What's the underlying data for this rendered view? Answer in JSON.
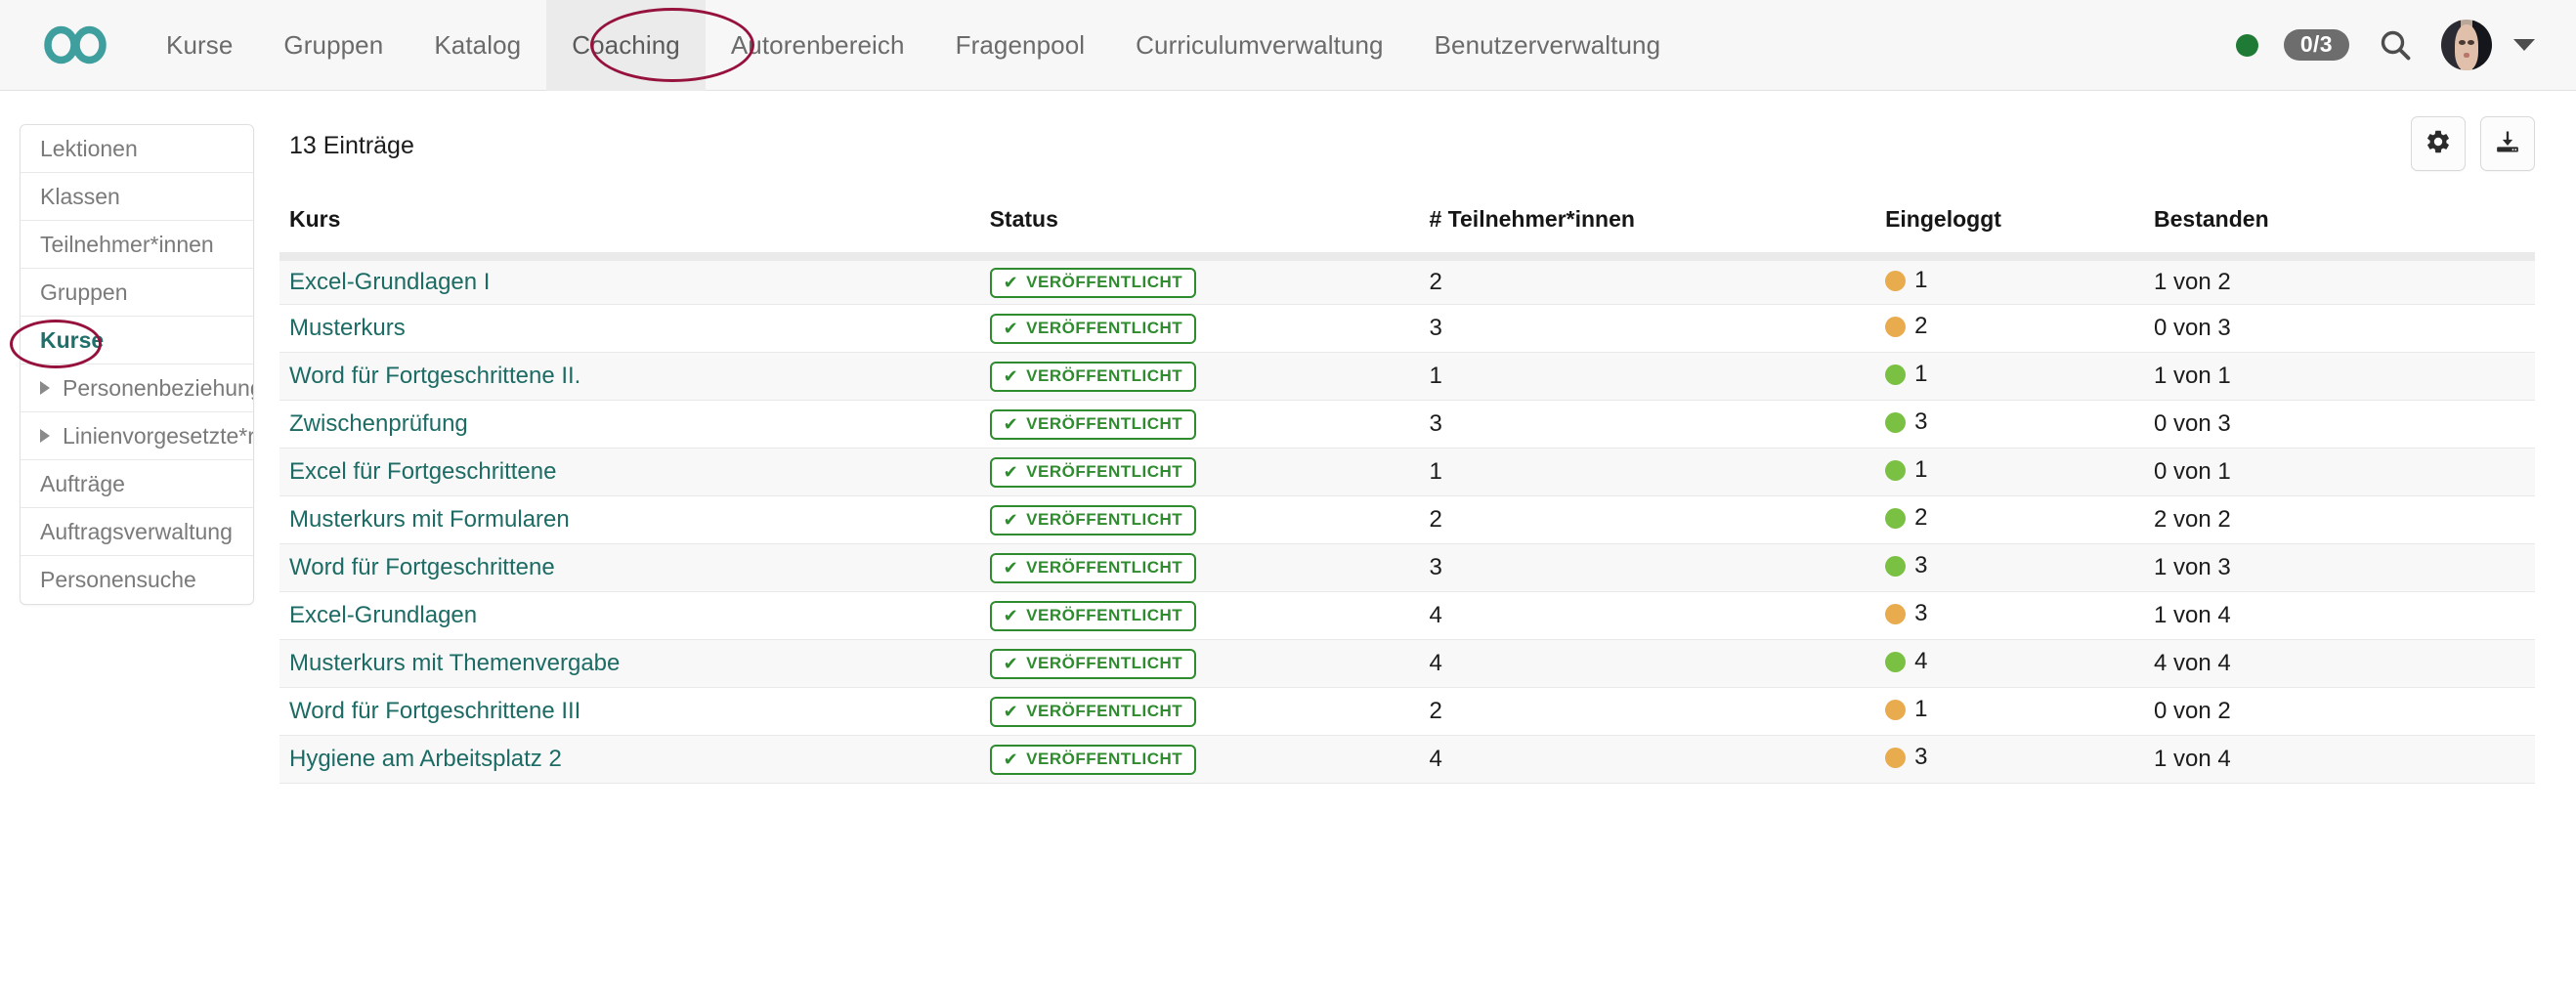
{
  "header": {
    "logo_icon": "infinity-logo",
    "nav_items": [
      {
        "label": "Kurse",
        "active": false
      },
      {
        "label": "Gruppen",
        "active": false
      },
      {
        "label": "Katalog",
        "active": false
      },
      {
        "label": "Coaching",
        "active": true
      },
      {
        "label": "Autorenbereich",
        "active": false
      },
      {
        "label": "Fragenpool",
        "active": false
      },
      {
        "label": "Curriculumverwaltung",
        "active": false
      },
      {
        "label": "Benutzerverwaltung",
        "active": false
      }
    ],
    "status_dot_color": "#1f7a35",
    "task_badge": "0/3",
    "search_icon": "search-icon",
    "avatar_icon": "user-avatar",
    "account_caret_icon": "chevron-down-icon"
  },
  "annotations": [
    {
      "name": "coaching-nav-highlight",
      "color": "#96123c"
    },
    {
      "name": "kurse-sidebar-highlight",
      "color": "#96123c"
    }
  ],
  "sidebar": {
    "items": [
      {
        "label": "Lektionen",
        "expandable": false,
        "current": false
      },
      {
        "label": "Klassen",
        "expandable": false,
        "current": false
      },
      {
        "label": "Teilnehmer*innen",
        "expandable": false,
        "current": false
      },
      {
        "label": "Gruppen",
        "expandable": false,
        "current": false
      },
      {
        "label": "Kurse",
        "expandable": false,
        "current": true
      },
      {
        "label": "Personenbeziehungen",
        "expandable": true,
        "current": false
      },
      {
        "label": "Linienvorgesetzte*r",
        "expandable": true,
        "current": false
      },
      {
        "label": "Aufträge",
        "expandable": false,
        "current": false
      },
      {
        "label": "Auftragsverwaltung",
        "expandable": false,
        "current": false
      },
      {
        "label": "Personensuche",
        "expandable": false,
        "current": false
      }
    ]
  },
  "main": {
    "entry_count_label": "13 Einträge",
    "actions": [
      {
        "name": "settings-button",
        "icon": "gear-icon"
      },
      {
        "name": "download-button",
        "icon": "download-icon"
      }
    ],
    "table": {
      "columns": [
        "Kurs",
        "Status",
        "# Teilnehmer*innen",
        "Eingeloggt",
        "Bestanden"
      ],
      "status_badge_label": "VERÖFFENTLICHT",
      "status_badge_icon": "check-icon",
      "rows": [
        {
          "kurs": "Excel-Grundlagen I",
          "status": "VERÖFFENTLICHT",
          "teilnehmer": "2",
          "eingeloggt": "1",
          "eingeloggt_dot": "orange",
          "bestanden": "1 von 2"
        },
        {
          "kurs": "Musterkurs",
          "status": "VERÖFFENTLICHT",
          "teilnehmer": "3",
          "eingeloggt": "2",
          "eingeloggt_dot": "orange",
          "bestanden": "0 von 3"
        },
        {
          "kurs": "Word für Fortgeschrittene II.",
          "status": "VERÖFFENTLICHT",
          "teilnehmer": "1",
          "eingeloggt": "1",
          "eingeloggt_dot": "green",
          "bestanden": "1 von 1"
        },
        {
          "kurs": "Zwischenprüfung",
          "status": "VERÖFFENTLICHT",
          "teilnehmer": "3",
          "eingeloggt": "3",
          "eingeloggt_dot": "green",
          "bestanden": "0 von 3"
        },
        {
          "kurs": "Excel für Fortgeschrittene",
          "status": "VERÖFFENTLICHT",
          "teilnehmer": "1",
          "eingeloggt": "1",
          "eingeloggt_dot": "green",
          "bestanden": "0 von 1"
        },
        {
          "kurs": "Musterkurs mit Formularen",
          "status": "VERÖFFENTLICHT",
          "teilnehmer": "2",
          "eingeloggt": "2",
          "eingeloggt_dot": "green",
          "bestanden": "2 von 2"
        },
        {
          "kurs": "Word für Fortgeschrittene",
          "status": "VERÖFFENTLICHT",
          "teilnehmer": "3",
          "eingeloggt": "3",
          "eingeloggt_dot": "green",
          "bestanden": "1 von 3"
        },
        {
          "kurs": "Excel-Grundlagen",
          "status": "VERÖFFENTLICHT",
          "teilnehmer": "4",
          "eingeloggt": "3",
          "eingeloggt_dot": "orange",
          "bestanden": "1 von 4"
        },
        {
          "kurs": "Musterkurs mit Themenvergabe",
          "status": "VERÖFFENTLICHT",
          "teilnehmer": "4",
          "eingeloggt": "4",
          "eingeloggt_dot": "green",
          "bestanden": "4 von 4"
        },
        {
          "kurs": "Word für Fortgeschrittene III",
          "status": "VERÖFFENTLICHT",
          "teilnehmer": "2",
          "eingeloggt": "1",
          "eingeloggt_dot": "orange",
          "bestanden": "0 von 2"
        },
        {
          "kurs": "Hygiene am Arbeitsplatz 2",
          "status": "VERÖFFENTLICHT",
          "teilnehmer": "4",
          "eingeloggt": "3",
          "eingeloggt_dot": "orange",
          "bestanden": "1 von 4"
        }
      ]
    }
  },
  "colors": {
    "brand_teal": "#3f9e9e",
    "link_teal": "#1c6b64",
    "badge_green": "#2e8b2e",
    "dot_green": "#7ac143",
    "dot_orange": "#e8ab4e",
    "annotation_red": "#96123c"
  }
}
